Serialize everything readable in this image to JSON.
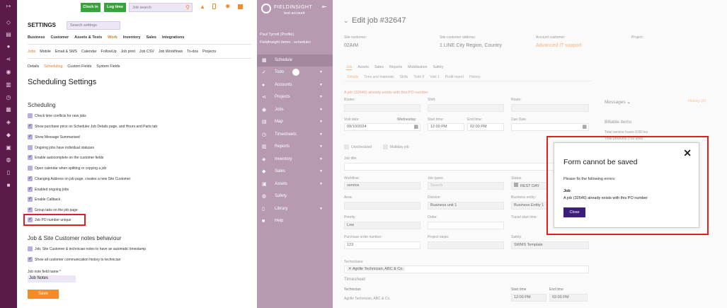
{
  "topbar": {
    "clock_in": "Clock in",
    "log_time": "Log time",
    "search_placeholder": "Job search"
  },
  "settings": {
    "title": "SETTINGS",
    "search_placeholder": "Search settings",
    "main_tabs": [
      "Business",
      "Customer",
      "Assets & Tests",
      "Work",
      "Inventory",
      "Sales",
      "Integrations"
    ],
    "work_tabs": [
      "Jobs",
      "Mobile",
      "Email & SMS",
      "Calendar",
      "FollowUp",
      "Job print",
      "Job CSV",
      "Job Workflows",
      "To-dos",
      "Projects"
    ],
    "job_tabs": [
      "Details",
      "Scheduling",
      "Custom Fields",
      "System Fields"
    ],
    "page_title": "Scheduling Settings",
    "section1": "Scheduling",
    "options": [
      {
        "label": "Check time conflicts for new jobs",
        "checked": false
      },
      {
        "label": "Show purchase price on Scheduler Job Details page, and Hours and Parts tab",
        "checked": true
      },
      {
        "label": "Show Message Summarised",
        "checked": true
      },
      {
        "label": "Ongoing jobs have individual statuses",
        "checked": false
      },
      {
        "label": "Enable autocomplete on the customer fields",
        "checked": true
      },
      {
        "label": "Open calendar when splitting or copying a job",
        "checked": false
      },
      {
        "label": "Changing Address on job page, creates a new Site Customer",
        "checked": true
      },
      {
        "label": "Enabled ongoing jobs",
        "checked": true
      },
      {
        "label": "Enable Callback",
        "checked": true
      },
      {
        "label": "Group tabs on the job page",
        "checked": true
      },
      {
        "label": "Job PO number unique",
        "checked": true
      }
    ],
    "section2": "Job & Site Customer notes behaviour",
    "options2": [
      {
        "label": "Job, Site Customer & technician notes to have an automatic timestamp",
        "checked": false
      },
      {
        "label": "Show all customer communication history to technician",
        "checked": true
      }
    ],
    "note_field_label": "Job note field name *",
    "note_field_value": "Job Notes",
    "save": "Save"
  },
  "nav": {
    "logo_line1": "FIELDINSIGHT",
    "logo_line2": "test account",
    "user": "Paul Tyrrell (Profile)",
    "company": "FieldInsight demo - scheduler",
    "items": [
      {
        "label": "Schedule",
        "icon": "calendar-icon",
        "icon_glyph": "▦",
        "caret": false
      },
      {
        "label": "Todo",
        "icon": "check-icon",
        "icon_glyph": "✓",
        "caret": true
      },
      {
        "label": "Accounts",
        "icon": "user-icon",
        "icon_glyph": "●",
        "caret": true
      },
      {
        "label": "Projects",
        "icon": "share-icon",
        "icon_glyph": "⋖",
        "caret": true
      },
      {
        "label": "Jobs",
        "icon": "pin-icon",
        "icon_glyph": "◉",
        "caret": true
      },
      {
        "label": "Map",
        "icon": "map-icon",
        "icon_glyph": "▤",
        "caret": true
      },
      {
        "label": "Timesheets",
        "icon": "clock-icon",
        "icon_glyph": "◷",
        "caret": true
      },
      {
        "label": "Reports",
        "icon": "report-icon",
        "icon_glyph": "▥",
        "caret": true
      },
      {
        "label": "Inventory",
        "icon": "cube-icon",
        "icon_glyph": "◈",
        "caret": true
      },
      {
        "label": "Sales",
        "icon": "tag-icon",
        "icon_glyph": "◆",
        "caret": true
      },
      {
        "label": "Assets",
        "icon": "asset-icon",
        "icon_glyph": "▣",
        "caret": true
      },
      {
        "label": "Safety",
        "icon": "shield-icon",
        "icon_glyph": "◍",
        "caret": false
      },
      {
        "label": "Library",
        "icon": "book-icon",
        "icon_glyph": "▯",
        "caret": true
      },
      {
        "label": "Help",
        "icon": "help-icon",
        "icon_glyph": "■",
        "caret": false
      }
    ]
  },
  "job": {
    "title": "Edit job #32647",
    "site_customer_label": "Site customer:",
    "site_customer": "02AIM",
    "site_address_label": "Site customer address:",
    "site_address": "1 LINE City Region, Country",
    "account_label": "Account customer:",
    "account": "Advanced IT support",
    "project_label": "Project:",
    "tabs": [
      "Job",
      "Assets",
      "Sales",
      "Reports",
      "Mobilisation",
      "Safety"
    ],
    "subtabs": [
      "Details",
      "Time and materials",
      "Skills",
      "Todo 0",
      "Visit 1",
      "Profit report",
      "History"
    ],
    "error_banner": "A job (32646) already exists with this PO number",
    "roster_label": "Roster:",
    "shift_label": "Shift:",
    "route_label": "Route:",
    "visit_date_label": "Visit date:",
    "visit_day": "Wednesday",
    "visit_date": "09/10/2024",
    "start_time_label": "Start time:",
    "start_time": "12:00 PM",
    "end_time_label": "End time:",
    "end_time": "02:00 PM",
    "due_date_label": "Due Date",
    "unscheduled": "Unscheduled",
    "multiday": "Multiday job",
    "job_title_label": "Job title:",
    "workflow_label": "Workflow:",
    "workflow": "service",
    "job_types_label": "Job types:",
    "job_types": "Search",
    "status_label": "Status:",
    "status": "REST DAY",
    "area_label": "Area:",
    "division_label": "Division:",
    "division": "Business unit 1",
    "business_entity_label": "Business entity:",
    "business_entity": "Business Entity 1",
    "priority_label": "Priority:",
    "priority": "Low",
    "order_label": "Order:",
    "travel_label": "Travel start time:",
    "po_label": "Purchase order number:",
    "po": "123",
    "project_steps_label": "Project steps:",
    "safety_label": "Safety:",
    "safety": "SWMS Template",
    "technicians_label": "Technicians:",
    "technicians": "✕ Agrille Technician, ABC & Co.",
    "timesheet": "Timesheet",
    "technician_col": "Technician",
    "technician_val": "Agrille Technician, ABC & Co.",
    "start_time_col": "Start time",
    "end_time_col": "End time",
    "ts_start": "12:00 PM",
    "ts_end": "02:00 PM",
    "messages": "Messages",
    "history_link": "History (0)",
    "billable": "Billable items",
    "billable_lines": [
      "Total service hours    0:00 hrs",
      "Total products         0:00 units"
    ]
  },
  "dialog": {
    "title": "Form cannot be saved",
    "intro": "Please fix the following errors:",
    "field": "Job",
    "message": "A job (32646) already exists with this PO number",
    "close": "Close"
  },
  "colors": {
    "accent": "#6b3aa0",
    "green": "#3aa23a",
    "orange": "#f28c28",
    "error": "#e02020",
    "nav": "#b79ab0",
    "iconbar": "#5a1a4a"
  }
}
